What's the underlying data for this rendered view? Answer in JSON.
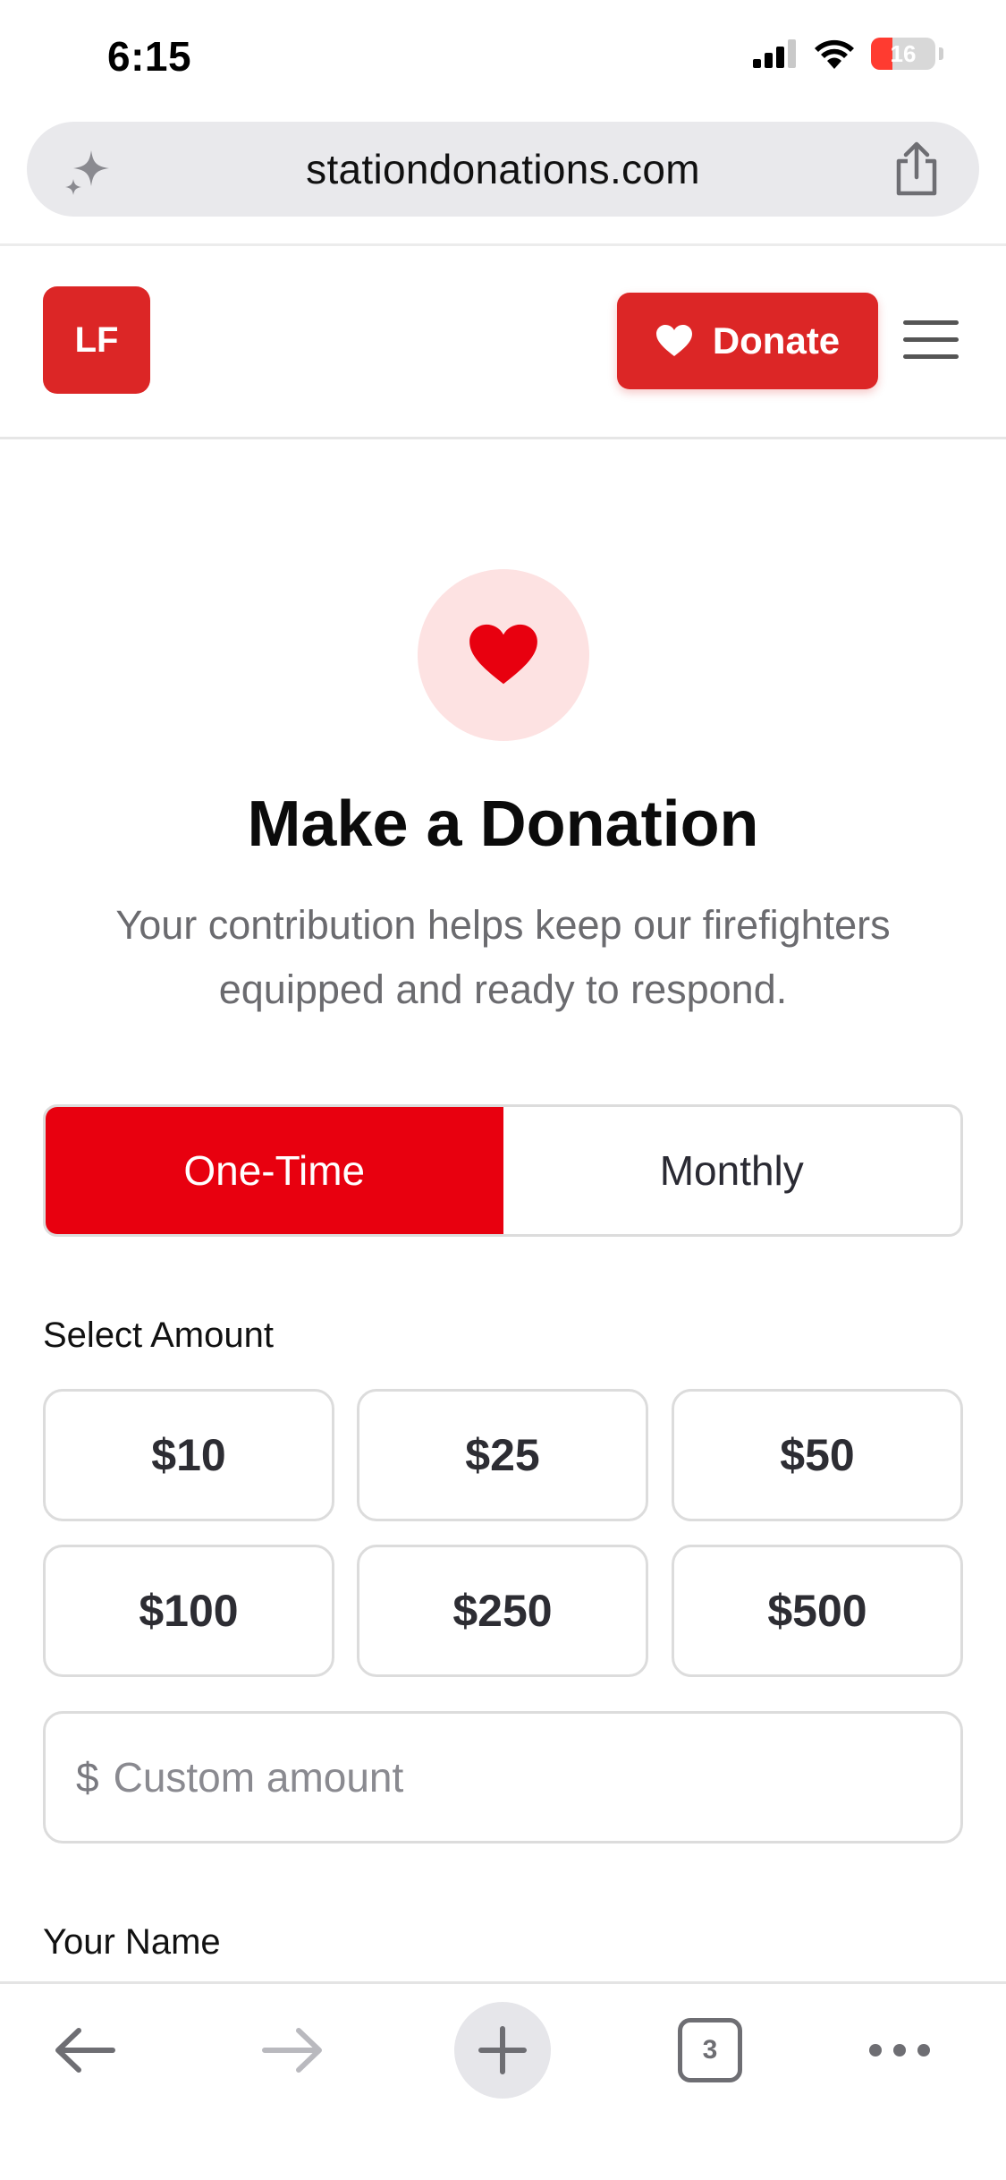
{
  "status_bar": {
    "time": "6:15",
    "battery_level": "16"
  },
  "browser": {
    "url": "stationdonations.com"
  },
  "site_header": {
    "logo_text": "LF",
    "donate_label": "Donate"
  },
  "hero": {
    "title": "Make a Donation",
    "subtitle": "Your contribution helps keep our firefighters equipped and ready to respond."
  },
  "frequency": {
    "options": [
      "One-Time",
      "Monthly"
    ],
    "selected": "One-Time"
  },
  "amount": {
    "label": "Select Amount",
    "options": [
      "$10",
      "$25",
      "$50",
      "$100",
      "$250",
      "$500"
    ],
    "currency_symbol": "$",
    "custom_placeholder": "Custom amount"
  },
  "form": {
    "name_label": "Your Name"
  },
  "toolbar": {
    "tab_count": "3"
  },
  "colors": {
    "brand_red": "#dc2626",
    "toggle_active": "#e8000f",
    "heart_bg": "#fde2e2"
  }
}
